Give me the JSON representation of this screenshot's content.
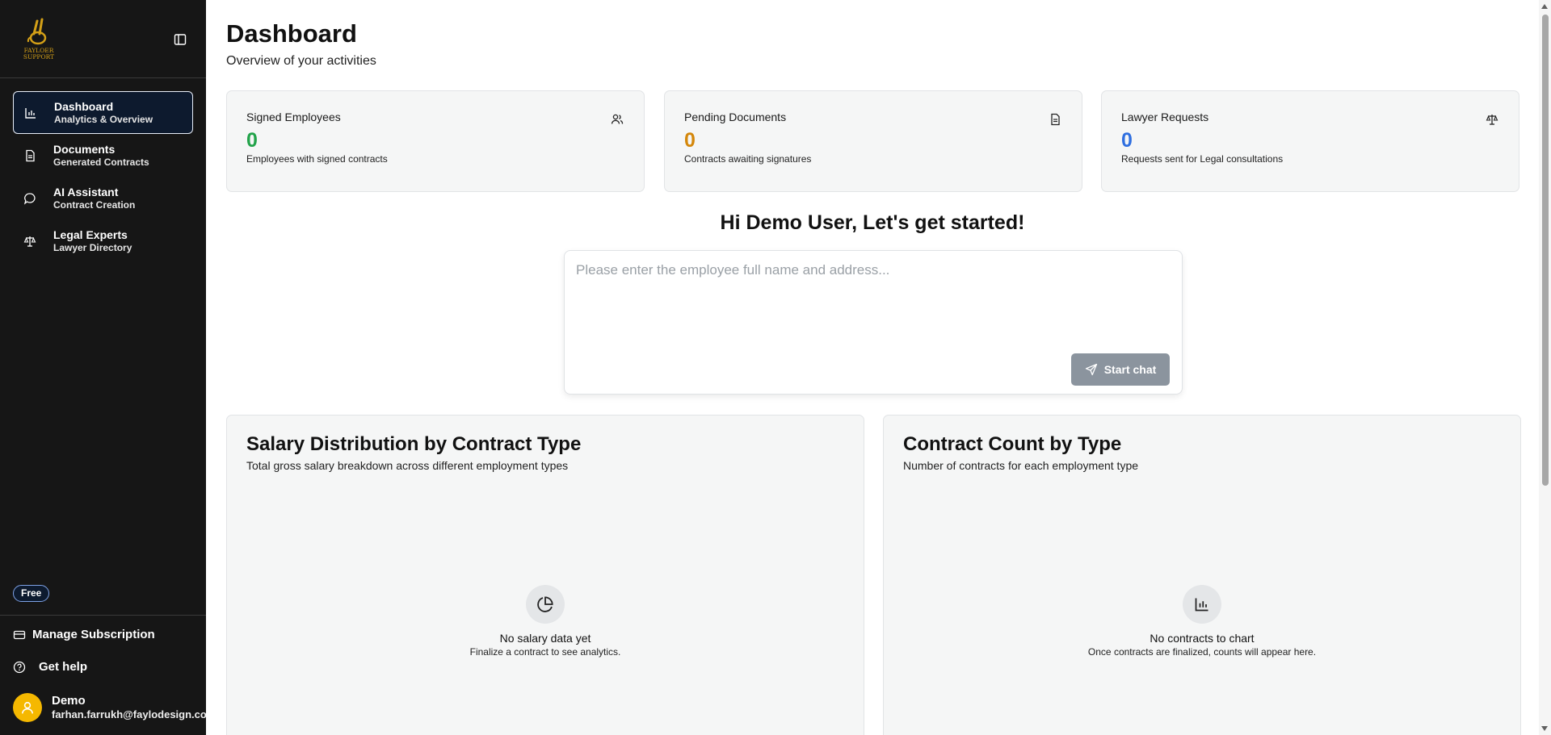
{
  "sidebar": {
    "logo_alt": "FAYLOER SUPPORT",
    "nav": [
      {
        "title": "Dashboard",
        "subtitle": "Analytics & Overview",
        "icon": "bar-chart-icon"
      },
      {
        "title": "Documents",
        "subtitle": "Generated Contracts",
        "icon": "document-icon"
      },
      {
        "title": "AI Assistant",
        "subtitle": "Contract Creation",
        "icon": "chat-bubble-icon"
      },
      {
        "title": "Legal Experts",
        "subtitle": "Lawyer Directory",
        "icon": "scale-icon"
      }
    ],
    "plan_badge": "Free",
    "manage_subscription": "Manage Subscription",
    "get_help": "Get help",
    "user": {
      "name": "Demo",
      "email": "farhan.farrukh@faylodesign.com.au"
    }
  },
  "header": {
    "title": "Dashboard",
    "subtitle": "Overview of your activities"
  },
  "stats": [
    {
      "title": "Signed Employees",
      "value": "0",
      "desc": "Employees with signed contracts",
      "color": "#22a34a",
      "icon": "users-icon"
    },
    {
      "title": "Pending Documents",
      "value": "0",
      "desc": "Contracts awaiting signatures",
      "color": "#d4870b",
      "icon": "document-icon"
    },
    {
      "title": "Lawyer Requests",
      "value": "0",
      "desc": "Requests sent for Legal consultations",
      "color": "#2f6fe0",
      "icon": "scale-icon"
    }
  ],
  "greeting": "Hi Demo User, Let's get started!",
  "chat": {
    "placeholder": "Please enter the employee full name and address...",
    "start_label": "Start chat"
  },
  "charts": [
    {
      "title": "Salary Distribution by Contract Type",
      "subtitle": "Total gross salary breakdown across different employment types",
      "empty_title": "No salary data yet",
      "empty_sub": "Finalize a contract to see analytics.",
      "icon": "pie-chart-icon"
    },
    {
      "title": "Contract Count by Type",
      "subtitle": "Number of contracts for each employment type",
      "empty_title": "No contracts to chart",
      "empty_sub": "Once contracts are finalized, counts will appear here.",
      "icon": "bar-chart-icon"
    }
  ],
  "colors": {
    "sidebar_bg": "#161616",
    "active_nav_bg": "#0d1a2e",
    "avatar": "#f5b800",
    "start_button": "#8b949e"
  }
}
